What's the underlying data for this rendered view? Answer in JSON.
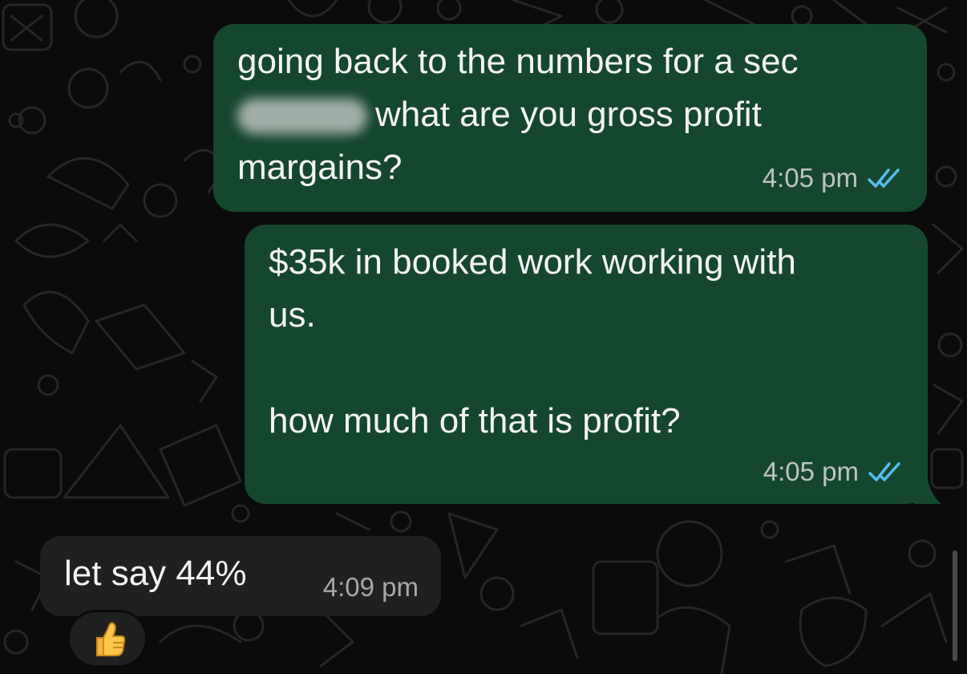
{
  "messages": [
    {
      "direction": "outgoing",
      "lines": [
        "going back to the numbers for a sec",
        "what are you gross profit",
        "margains?"
      ],
      "time": "4:05 pm",
      "status": "read",
      "blurred_text": true
    },
    {
      "direction": "outgoing",
      "lines": [
        "$35k in booked work working with",
        "us.",
        "",
        "how much of that is profit?"
      ],
      "time": "4:05 pm",
      "status": "read"
    },
    {
      "direction": "incoming",
      "lines": [
        "let say 44%"
      ],
      "time": "4:09 pm",
      "reaction": "thumbs-up-icon"
    }
  ],
  "colors": {
    "background": "#0b0b0b",
    "outgoing_bubble": "#15472f",
    "incoming_bubble": "#202020",
    "read_ticks": "#53bdeb",
    "text": "#f3f3f3"
  }
}
